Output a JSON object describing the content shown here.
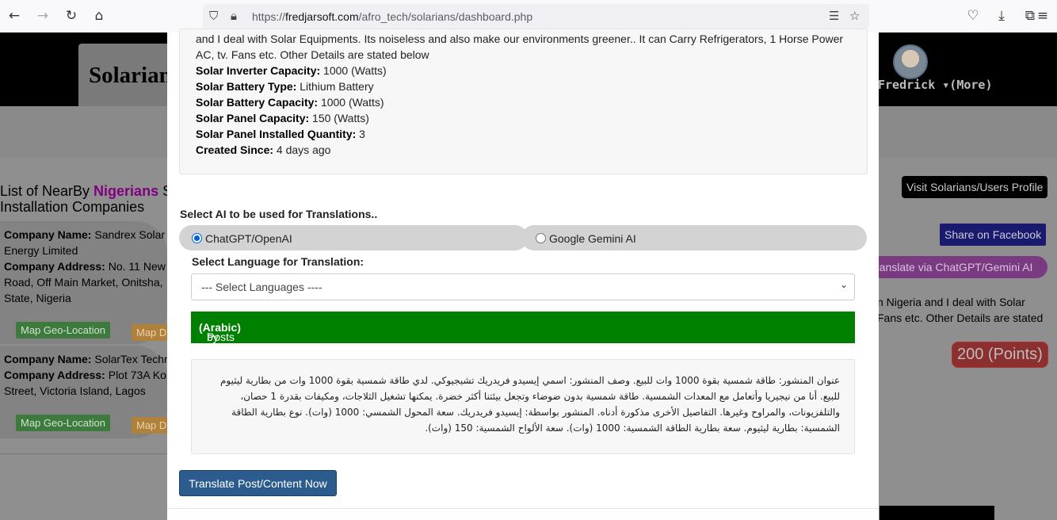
{
  "browser": {
    "url_prefix": "https://",
    "url_host": "fredjarsoft.com",
    "url_path": "/afro_tech/solarians/dashboard.php",
    "icons": [
      "back-icon",
      "forward-icon",
      "reload-icon",
      "home-icon",
      "shield-icon",
      "lock-icon",
      "reader-icon",
      "star-icon",
      "pocket-icon",
      "download-icon",
      "extensions-icon",
      "menu-icon"
    ]
  },
  "background": {
    "logo": "Solarians",
    "user_name": "Fredrick",
    "more_label": "▾(More)",
    "list_title_prefix": "List of NearBy ",
    "list_title_highlight": "Nigerians",
    "list_title_suffix": " S",
    "list_title_line2": "Installation Companies",
    "companies": [
      {
        "name_label": "Company Name:",
        "name_value": " Sandrex Solar",
        "name_cont": "Energy Limited",
        "addr_label": "Company Address:",
        "addr_value": " No. 11 New",
        "addr_line2": "Road, Off Main Market, Onitsha,",
        "addr_line3": "State, Nigeria",
        "map_btn": "Map Geo-Location",
        "dir_btn": "Map Di"
      },
      {
        "name_label": "Company Name:",
        "name_value": " SolarTex Techn",
        "addr_label": "Company Address:",
        "addr_value": " Plot 73A Ko",
        "addr_line2": "Street, Victoria Island, Lagos",
        "map_btn": "Map Geo-Location",
        "dir_btn": "Map Di"
      }
    ],
    "profile_btn": "Visit Solarians/Users Profile",
    "facebook_btn": "Share on Facebook",
    "translate_ai_btn": "ranslate via ChatGPT/Gemini AI",
    "right_text_1": "n Nigeria and I deal with Solar",
    "right_text_2": "Fans etc. Other Details are stated",
    "points": "200 (Points)",
    "colors": {
      "topbar": "#000000",
      "overlay": "#8f8f8f",
      "highlight": "#800080"
    }
  },
  "modal": {
    "description_line1": "and I deal with Solar Equipments. Its noiseless and also make our environments greener.. It can Carry Refrigerators, 1 Horse Power",
    "description_line2": "AC, tv. Fans etc. Other Details are stated below",
    "details": [
      {
        "label": "Solar Inverter Capacity:",
        "value": " 1000 (Watts)"
      },
      {
        "label": "Solar Battery Type:",
        "value": " Lithium Battery"
      },
      {
        "label": "Solar Battery Capacity:",
        "value": " 1000 (Watts)"
      },
      {
        "label": "Solar Panel Capacity:",
        "value": " 150 (Watts)"
      },
      {
        "label": "Solar Panel Installed Quantity:",
        "value": " 3"
      }
    ],
    "created_label": "Created Since:",
    "created_value": " 4 days ago",
    "ai_select_label": "Select AI to be used for Translations..",
    "ai_options": [
      {
        "label": "ChatGPT/OpenAI",
        "selected": true
      },
      {
        "label": "Google Gemini AI",
        "selected": false
      }
    ],
    "language_label": "Select Language for Translation:",
    "language_select": "--- Select Languages ----",
    "success_prefix": "Posts Successfully Translated to ",
    "success_language": "(Arabic)",
    "success_suffix": " by ChatGPT/OpenAI....",
    "translated_text": "عنوان المنشور: طاقة شمسية بقوة 1000 وات للبيع. وصف المنشور: اسمي إيسيدو فريدريك تشيجيوكي. لدي طاقة شمسية بقوة 1000 وات من بطارية ليثيوم للبيع. أنا من نيجيريا وأتعامل مع المعدات الشمسية. طاقة شمسية بدون ضوضاء وتجعل بيئتنا أكثر خضرة. يمكنها تشغيل الثلاجات، ومكيفات بقدرة 1 حصان، والتلفزيونات، والمراوح وغيرها. التفاصيل الأخرى مذكورة أدناه. المنشور بواسطة: إيسيدو فريدريك. سعة المحول الشمسي: 1000 (وات). نوع بطارية الطاقة الشمسية: بطارية ليثيوم. سعة بطارية الطاقة الشمسية: 1000 (وات). سعة الألواح الشمسية: 150 (وات).",
    "translate_button": "Translate Post/Content Now",
    "colors": {
      "success": "#008000",
      "button": "#2c5b8e",
      "created": "#8b0000",
      "radio": "#0060df"
    }
  }
}
